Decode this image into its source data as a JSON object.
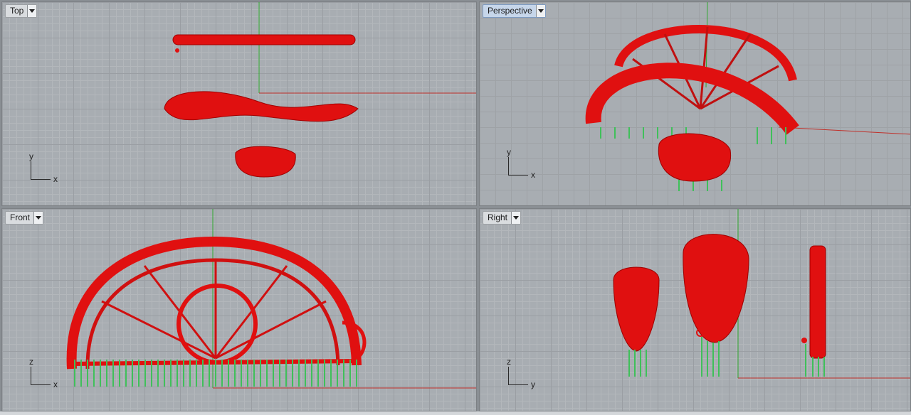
{
  "viewports": {
    "top": {
      "label": "Top",
      "axis_v": "y",
      "axis_h": "x"
    },
    "perspective": {
      "label": "Perspective",
      "axis_v": "y",
      "axis_h": "x"
    },
    "front": {
      "label": "Front",
      "axis_v": "z",
      "axis_h": "x"
    },
    "right": {
      "label": "Right",
      "axis_v": "z",
      "axis_h": "y"
    }
  },
  "active_viewport": "perspective",
  "colors": {
    "model_red": "#e01010",
    "model_dark": "#9e0000",
    "support_green": "#3fc05a",
    "axis_x": "#c0302a",
    "axis_y": "#2fa82f",
    "grid_bg": "#a8adb2"
  },
  "icons": {
    "viewport_menu": "chevron-down-icon"
  }
}
